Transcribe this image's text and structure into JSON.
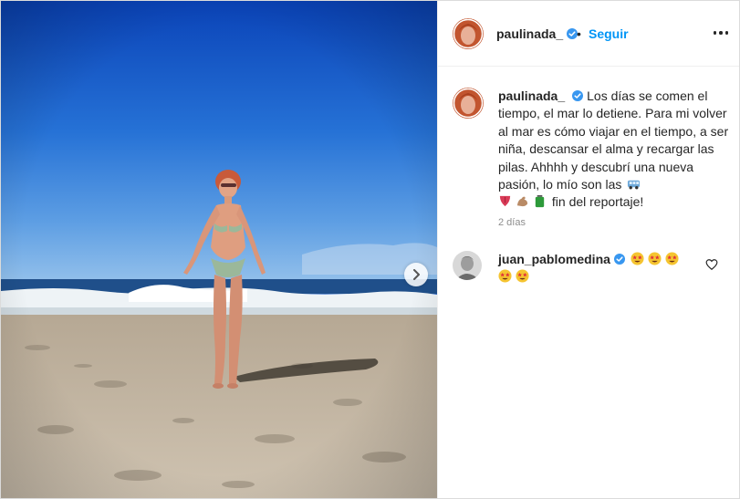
{
  "post": {
    "author": "paulinada_",
    "follow_label": "Seguir",
    "separator": "•",
    "caption_part1": "Los días se comen el tiempo, el mar lo detiene. Para mi volver al mar es cómo viajar en el tiempo, a ser niña, descansar el alma y recargar las pilas. Ahhhh y descubrí una nueva pasión, lo mío son las",
    "caption_part2": "fin del reportaje!",
    "caption_emojis": [
      "van-emoji",
      "tongue-emoji",
      "flexed-biceps-emoji",
      "battery-emoji"
    ],
    "time": "2 días"
  },
  "comments": [
    {
      "user": "juan_pablomedina",
      "emojis": [
        "star-struck-emoji",
        "star-struck-emoji",
        "star-struck-emoji",
        "star-struck-emoji",
        "star-struck-emoji"
      ]
    }
  ],
  "icons": {
    "verified": "verified-badge-icon",
    "more": "more-options-icon",
    "next": "chevron-right-icon",
    "like": "heart-icon"
  },
  "colors": {
    "link_blue": "#0095f6",
    "verified_blue": "#3897f0",
    "text": "#262626",
    "muted": "#8e8e8e"
  }
}
